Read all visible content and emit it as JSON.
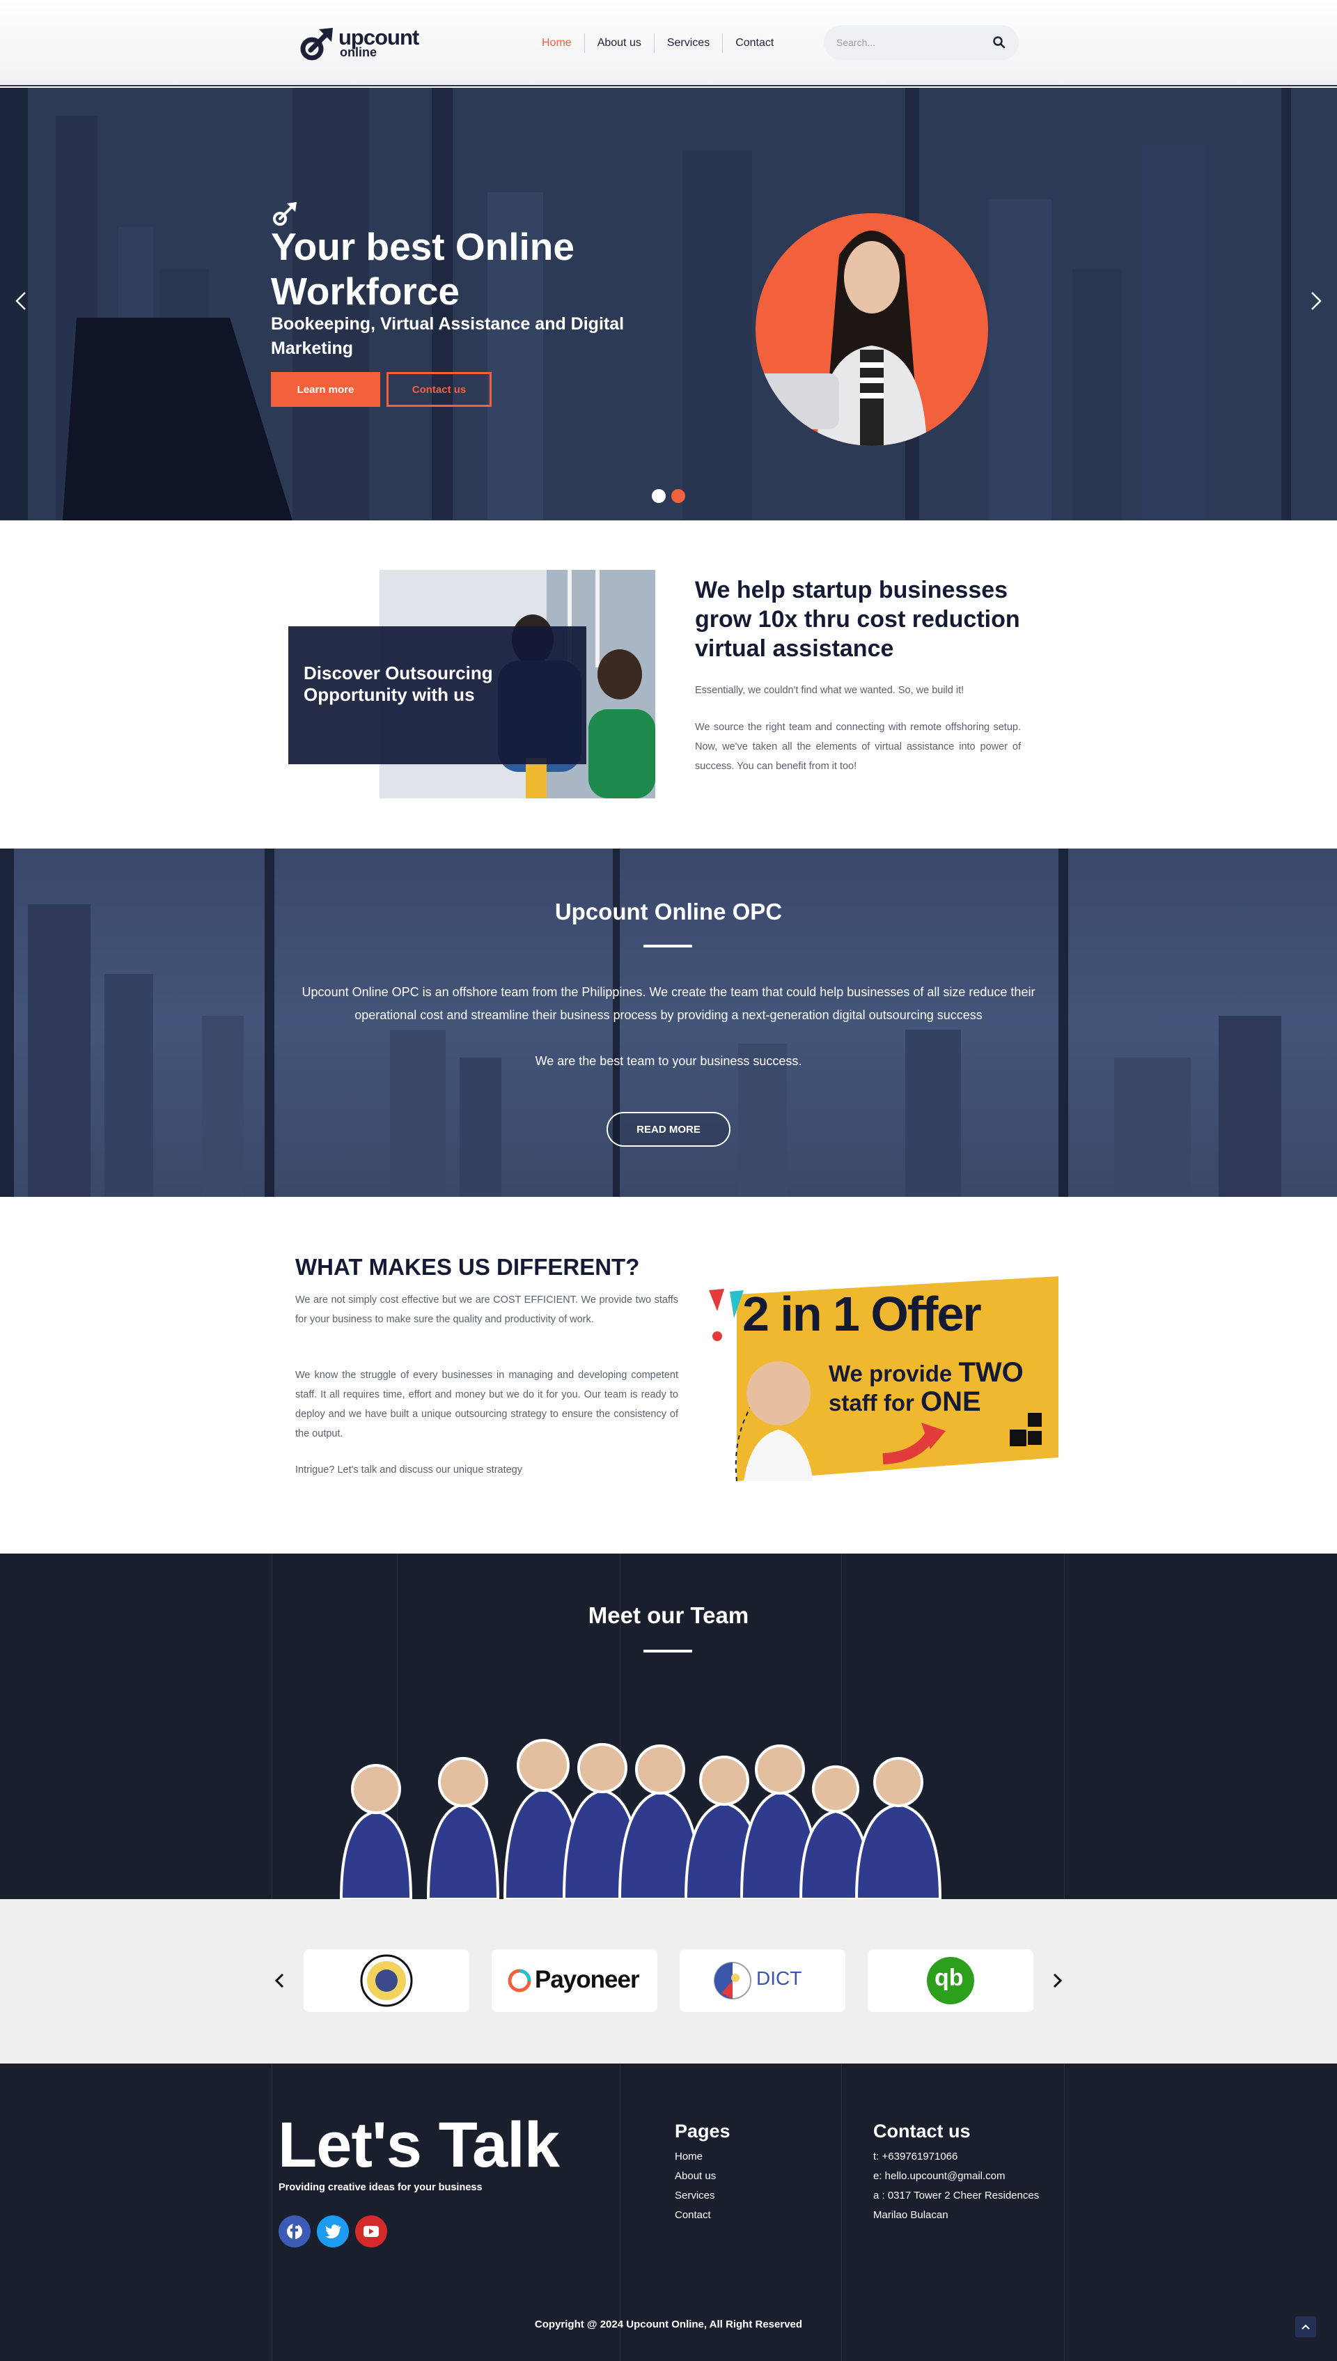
{
  "header": {
    "logo_text": "upcount",
    "logo_sub": "online",
    "nav": [
      {
        "label": "Home",
        "active": true
      },
      {
        "label": "About us",
        "active": false
      },
      {
        "label": "Services",
        "active": false
      },
      {
        "label": "Contact",
        "active": false
      }
    ],
    "search_placeholder": "Search...",
    "search_icon": "search-icon"
  },
  "hero": {
    "title": "Your best Online Workforce",
    "subtitle": "Bookeeping, Virtual Assistance and Digital Marketing",
    "learn_more": "Learn more",
    "contact_us": "Contact us",
    "slide_count": 2,
    "active_slide": 2
  },
  "about": {
    "box_text": "Discover Outsourcing Opportunity with us",
    "heading": "We help startup businesses grow 10x thru cost reduction virtual assistance",
    "p1": "Essentially, we couldn't find what we wanted. So, we build it!",
    "p2": "We source the right team and connecting with remote offshoring setup. Now, we've taken all the elements of virtual assistance into power of success. You can benefit from it too!"
  },
  "opc": {
    "title": "Upcount Online OPC",
    "text": "Upcount Online OPC is an offshore team from the Philippines. We create the team that could help businesses of all size reduce their operational cost and streamline their business process by providing a next-generation digital outsourcing success",
    "text2": "We are the best team to your business success.",
    "read_more": "READ MORE"
  },
  "different": {
    "heading": "WHAT MAKES US DIFFERENT?",
    "p1": "We are not simply cost effective but we are COST EFFICIENT. We provide two staffs for your business to make sure the quality and productivity of work.",
    "p2": "We know the struggle of every businesses in managing and developing competent staff. It all requires time, effort and money but we do it for you. Our team is ready to deploy and we have built a unique outsourcing strategy to ensure the consistency of the output.",
    "p3": "Intrigue? Let's talk and discuss our unique strategy",
    "offer_title": "2 in 1 Offer",
    "offer_line1": "We provide",
    "offer_two": "TWO",
    "offer_line2": "staff for",
    "offer_one": "ONE"
  },
  "team": {
    "title": "Meet our Team",
    "member_count": 9
  },
  "partners": {
    "logos": [
      "seal-logo",
      "Payoneer",
      "DICT",
      "qb"
    ]
  },
  "footer": {
    "talk": "Let's Talk",
    "talk_sub": "Providing creative ideas for your business",
    "social": [
      "facebook-icon",
      "twitter-icon",
      "youtube-icon"
    ],
    "pages_title": "Pages",
    "pages": [
      "Home",
      "About us",
      "Services",
      "Contact"
    ],
    "contact_title": "Contact us",
    "contact": [
      "t: +639761971066",
      "e: hello.upcount@gmail.com",
      "a : 0317 Tower 2 Cheer Residences",
      "Marilao Bulacan"
    ],
    "copyright": "Copyright @ 2024 Upcount Online, All Right Reserved"
  },
  "colors": {
    "accent": "#f2613c",
    "navy": "#141a33",
    "dark_bg": "#1a1f2e"
  }
}
